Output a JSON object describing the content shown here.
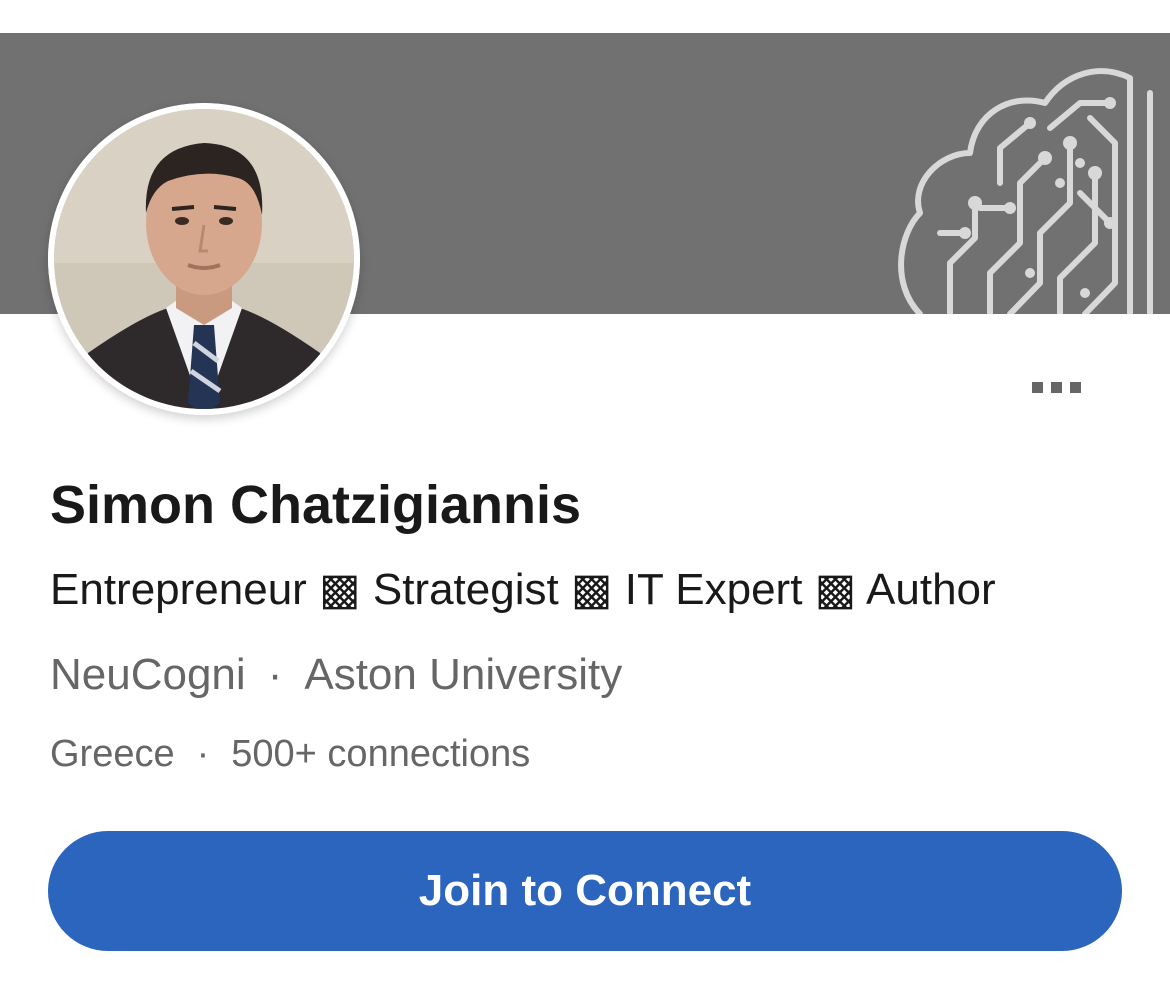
{
  "profile": {
    "name": "Simon Chatzigiannis",
    "headline": "Entrepreneur ▩ Strategist ▩ IT Expert ▩ Author",
    "company": "NeuCogni",
    "school": "Aston University",
    "location": "Greece",
    "connections": "500+ connections",
    "separator": "·"
  },
  "actions": {
    "join_label": "Join to Connect"
  },
  "icons": {
    "more": "more-options-icon",
    "banner_art": "circuit-brain-icon"
  },
  "colors": {
    "banner": "#717171",
    "primary_button": "#2c65bd",
    "name_text": "#191919",
    "secondary_text": "#666666"
  }
}
